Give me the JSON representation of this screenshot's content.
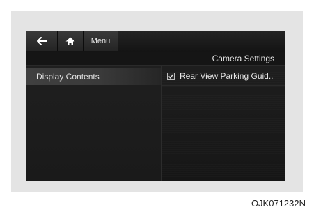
{
  "header": {
    "back_icon": "arrow-left-icon",
    "home_icon": "home-icon",
    "menu_label": "Menu"
  },
  "page_title": "Camera Settings",
  "left_menu": {
    "items": [
      {
        "label": "Display Contents",
        "selected": true
      }
    ]
  },
  "options": [
    {
      "label": "Rear View Parking Guid..",
      "checked": true
    }
  ],
  "figure_code": "OJK071232N",
  "colors": {
    "screen_bg": "#1c1c1c",
    "selected_item_bg": "#3a3a3a",
    "text": "#e6e6e6"
  }
}
